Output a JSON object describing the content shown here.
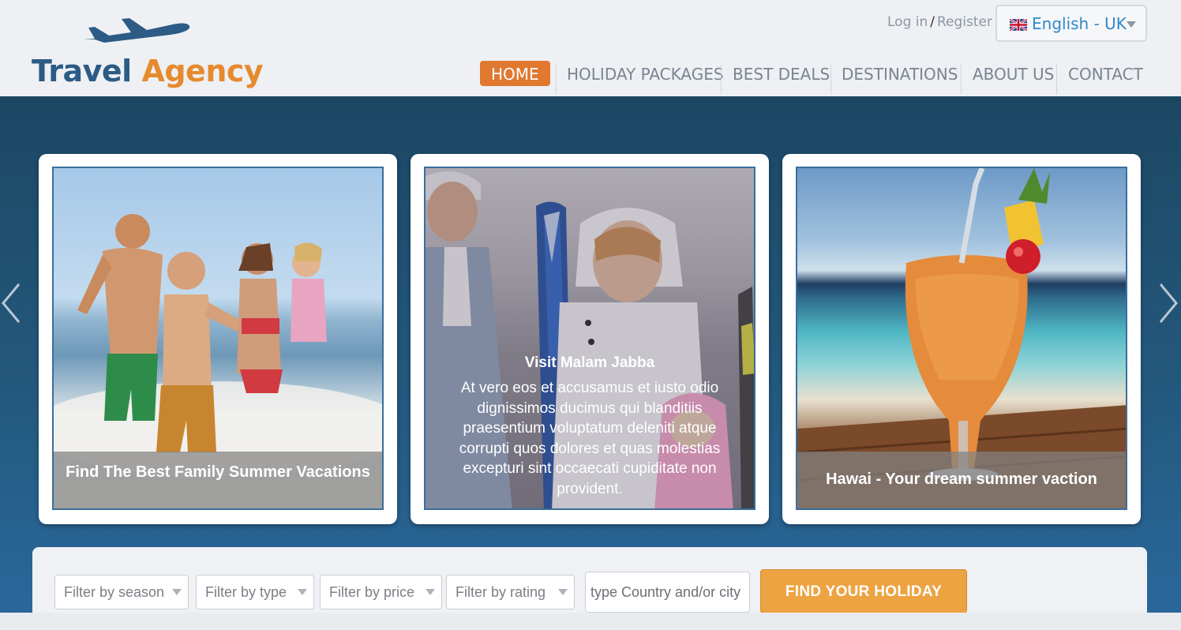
{
  "brand": {
    "name_part1": "Travel ",
    "name_part2": "Agency"
  },
  "auth": {
    "login": "Log in",
    "separator": "/",
    "register": "Register"
  },
  "language": {
    "selected": "English - UK",
    "flag_icon": "uk-flag-icon"
  },
  "nav": [
    {
      "label": "HOME",
      "active": true
    },
    {
      "label": "HOLIDAY PACKAGES",
      "active": false
    },
    {
      "label": "BEST DEALS",
      "active": false
    },
    {
      "label": "DESTINATIONS",
      "active": false
    },
    {
      "label": "ABOUT US",
      "active": false
    },
    {
      "label": "CONTACT",
      "active": false
    }
  ],
  "slides": [
    {
      "caption": "Find The Best Family Summer Vacations"
    },
    {
      "title": "Visit Malam Jabba",
      "text": "At vero eos et accusamus et iusto odio dignissimos ducimus qui blanditiis praesentium voluptatum deleniti atque corrupti quos dolores et quas molestias excepturi sint occaecati cupiditate non provident."
    },
    {
      "caption": "Hawai - Your dream summer vaction"
    }
  ],
  "search": {
    "filters": [
      "Filter by season",
      "Filter by type",
      "Filter by price",
      "Filter by rating"
    ],
    "placeholder": "type Country and/or city",
    "button": "FIND YOUR HOLIDAY"
  },
  "colors": {
    "accent": "#e0782f",
    "brand_blue": "#2c5b85",
    "hero": "#23587d",
    "button": "#eda342"
  }
}
